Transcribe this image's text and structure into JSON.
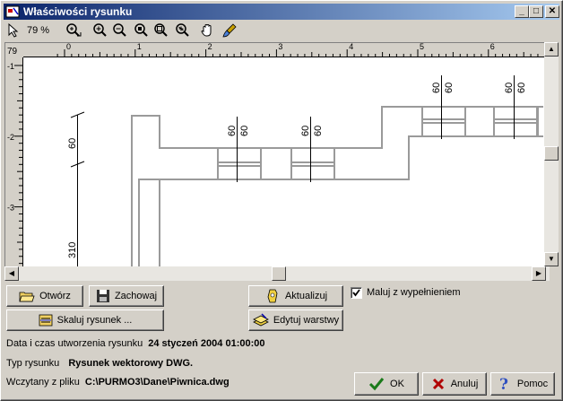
{
  "window": {
    "title": "Właściwości rysunku",
    "controls": {
      "minimize": "_",
      "maximize": "□",
      "close": "✕"
    }
  },
  "toolbar": {
    "zoom_level": "79 %",
    "tools": [
      "pointer-icon",
      "zoom-window-icon",
      "zoom-in-icon",
      "zoom-out-icon",
      "zoom-region-icon",
      "zoom-fit-icon",
      "zoom-all-icon",
      "pan-hand-icon",
      "paint-brush-icon"
    ]
  },
  "ruler": {
    "corner_label": "79",
    "top_ticks": [
      "0",
      "1",
      "2",
      "3",
      "4",
      "5",
      "6"
    ],
    "left_ticks": [
      "-1",
      "-2",
      "-3"
    ]
  },
  "drawing": {
    "dim_labels": [
      "60",
      "60",
      "60",
      "60",
      "60",
      "60",
      "60",
      "60",
      "60",
      "310"
    ]
  },
  "buttons": {
    "open": "Otwórz",
    "save": "Zachowaj",
    "scale": "Skaluj rysunek ...",
    "refresh": "Aktualizuj",
    "edit_layers": "Edytuj warstwy",
    "ok": "OK",
    "cancel": "Anuluj",
    "help": "Pomoc"
  },
  "fill_checkbox": {
    "label": "Maluj z wypełnieniem",
    "checked": true,
    "mark": "✓"
  },
  "info": {
    "created_label": "Data i czas utworzenia rysunku",
    "created_value": "24 styczeń 2004 01:00:00",
    "type_label": "Typ rysunku",
    "type_value": "Rysunek wektorowy DWG.",
    "file_label": "Wczytany z pliku",
    "file_value": "C:\\PURMO3\\Dane\\Piwnica.dwg"
  },
  "colors": {
    "titlebar_start": "#0a246a",
    "titlebar_end": "#a6caf0",
    "face": "#d4d0c8",
    "drawing_line": "#9a9a9a"
  }
}
